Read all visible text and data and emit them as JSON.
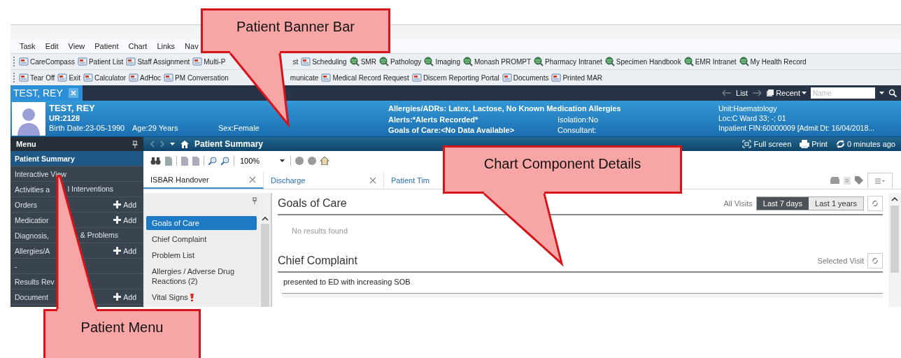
{
  "menu_bar": [
    "Task",
    "Edit",
    "View",
    "Patient",
    "Chart",
    "Links",
    "Nav"
  ],
  "toolbars": [
    [
      {
        "label": "CareCompass",
        "kind": "tool"
      },
      {
        "label": "Patient List",
        "kind": "tool"
      },
      {
        "label": "Staff Assignment",
        "kind": "tool"
      },
      {
        "label": "Multi-P",
        "kind": "tool"
      },
      {
        "label": "st",
        "kind": "cut"
      },
      {
        "label": "Scheduling",
        "kind": "tool"
      },
      {
        "label": "SMR",
        "kind": "link"
      },
      {
        "label": "Pathology",
        "kind": "link"
      },
      {
        "label": "Imaging",
        "kind": "link"
      },
      {
        "label": "Monash PROMPT",
        "kind": "link"
      },
      {
        "label": "Pharmacy Intranet",
        "kind": "link"
      },
      {
        "label": "Specimen Handbook",
        "kind": "link"
      },
      {
        "label": "EMR Intranet",
        "kind": "link"
      },
      {
        "label": "My Health Record",
        "kind": "link"
      }
    ],
    [
      {
        "label": "Tear Off",
        "kind": "tool"
      },
      {
        "label": "Exit",
        "kind": "tool"
      },
      {
        "label": "Calculator",
        "kind": "tool"
      },
      {
        "label": "AdHoc",
        "kind": "tool"
      },
      {
        "label": "PM Conversation",
        "kind": "tool"
      },
      {
        "label": "municate",
        "kind": "cut"
      },
      {
        "label": "Medical Record Request",
        "kind": "tool"
      },
      {
        "label": "Discern Reporting Portal",
        "kind": "tool"
      },
      {
        "label": "Documents",
        "kind": "tool"
      },
      {
        "label": "Printed MAR",
        "kind": "tool"
      }
    ]
  ],
  "patient_tab": {
    "label": "TEST, REY"
  },
  "chart_nav": {
    "list": "List",
    "recent": "Recent",
    "search_placeholder": "Name"
  },
  "patient": {
    "name": "TEST, REY",
    "ur": "UR:2128",
    "birth_date": "Birth Date:23-05-1990",
    "age": "Age:29 Years",
    "sex": "Sex:Female",
    "allergies": "Allergies/ADRs: Latex, Lactose, No Known Medication Allergies",
    "alerts": "Alerts:*Alerts Recorded*",
    "goals_of_care": "Goals of Care:<No Data Available>",
    "isolation": "Isolation:No",
    "consultant": "Consultant:",
    "unit": "Unit:Haematology",
    "location": "Loc:C Ward 33; -; 01",
    "encounter": "Inpatient FIN:60000009 [Admit Dt: 16/04/2018..."
  },
  "menu": {
    "title": "Menu",
    "items": [
      {
        "label": "Patient Summary",
        "selected": true
      },
      {
        "label": "Interactive View",
        "selected": false
      },
      {
        "label": "Activities a",
        "label_end": "l Interventions",
        "selected": false
      },
      {
        "label": "Orders",
        "action": "Add",
        "selected": false
      },
      {
        "label": "Medicatior",
        "action": "Add",
        "selected": false
      },
      {
        "label": "Diagnosis,",
        "label_end": "& Problems",
        "selected": false
      },
      {
        "label": "Allergies/A",
        "action": "Add",
        "selected": false
      },
      {
        "label": "-",
        "selected": false
      },
      {
        "label": "Results Rev",
        "selected": false
      },
      {
        "label": "Document",
        "action": "Add",
        "selected": false
      }
    ]
  },
  "page_header": {
    "title": "Patient Summary",
    "actions": [
      {
        "label": "Full screen",
        "kind": "fullscreen"
      },
      {
        "label": "Print",
        "kind": "print"
      },
      {
        "label": "0 minutes ago",
        "kind": "refresh"
      }
    ]
  },
  "toolbar": {
    "zoom": "100%"
  },
  "tabs": [
    {
      "label": "ISBAR Handover",
      "selected": true,
      "closable": true
    },
    {
      "label": "Discharge",
      "selected": false,
      "closable": true
    },
    {
      "label": "Patient Tim",
      "selected": false,
      "closable": false
    }
  ],
  "tab_tools": {
    "count": "0"
  },
  "sections_nav": [
    {
      "label": "Goals of Care",
      "selected": true,
      "alert": false
    },
    {
      "label": "Chief Complaint",
      "selected": false,
      "alert": false
    },
    {
      "label": "Problem List",
      "selected": false,
      "alert": false
    },
    {
      "label": "Allergies / Adverse Drug Reactions (2)",
      "selected": false,
      "alert": false
    },
    {
      "label": "Vital Signs",
      "selected": false,
      "alert": true
    }
  ],
  "components": [
    {
      "title": "Goals of Care",
      "filter_label": "All Visits",
      "filters": [
        {
          "label": "Last 7 days",
          "selected": true
        },
        {
          "label": "Last 1 years",
          "selected": false
        }
      ],
      "body": "No results found",
      "kind": "empty"
    },
    {
      "title": "Chief Complaint",
      "filter_label": "Selected Visit",
      "body": "presented to ED with increasing SOB",
      "kind": "text"
    }
  ],
  "callouts": [
    {
      "text": "Patient Banner Bar"
    },
    {
      "text": "Chart Component Details"
    },
    {
      "text": "Patient Menu"
    }
  ]
}
